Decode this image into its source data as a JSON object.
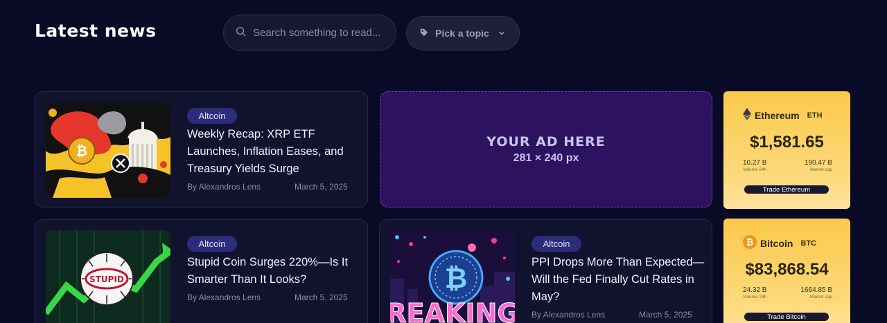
{
  "header": {
    "title": "Latest news",
    "search_placeholder": "Search something to read...",
    "topic_label": "Pick a topic"
  },
  "articles": [
    {
      "tag": "Altcoin",
      "title": "Weekly Recap: XRP ETF Launches, Inflation Eases, and Treasury Yields Surge",
      "author": "By Alexandros Lens",
      "date": "March 5, 2025"
    },
    {
      "tag": "Altcoin",
      "title": "Stupid Coin Surges 220%—Is It Smarter Than It Looks?",
      "author": "By Alexandros Lens",
      "date": "March 5, 2025",
      "image_text": "STUPID"
    },
    {
      "tag": "Altcoin",
      "title": "PPI Drops More Than Expected—Will the Fed Finally Cut Rates in May?",
      "author": "By Alexandros Lens",
      "date": "March 5, 2025",
      "image_text": "REAKING"
    }
  ],
  "ad": {
    "title": "YOUR AD HERE",
    "size": "281 × 240 px"
  },
  "tickers": [
    {
      "name": "Ethereum",
      "symbol": "ETH",
      "price": "$1,581.65",
      "volume": "10.27 B",
      "volume_label": "Volume 24h",
      "market_cap": "190.47 B",
      "market_cap_label": "Market cap",
      "button": "Trade Ethereum",
      "icon": "ethereum-icon"
    },
    {
      "name": "Bitcoin",
      "symbol": "BTC",
      "price": "$83,868.54",
      "volume": "24.32 B",
      "volume_label": "Volume 24h",
      "market_cap": "1664.85 B",
      "market_cap_label": "Market cap",
      "button": "Trade Bitcoin",
      "icon": "bitcoin-icon"
    }
  ],
  "colors": {
    "background": "#080a26",
    "card": "#11132e",
    "badge": "#2a2d7a",
    "ad_background": "#2d1260",
    "coin_card": "#fbc94a"
  }
}
